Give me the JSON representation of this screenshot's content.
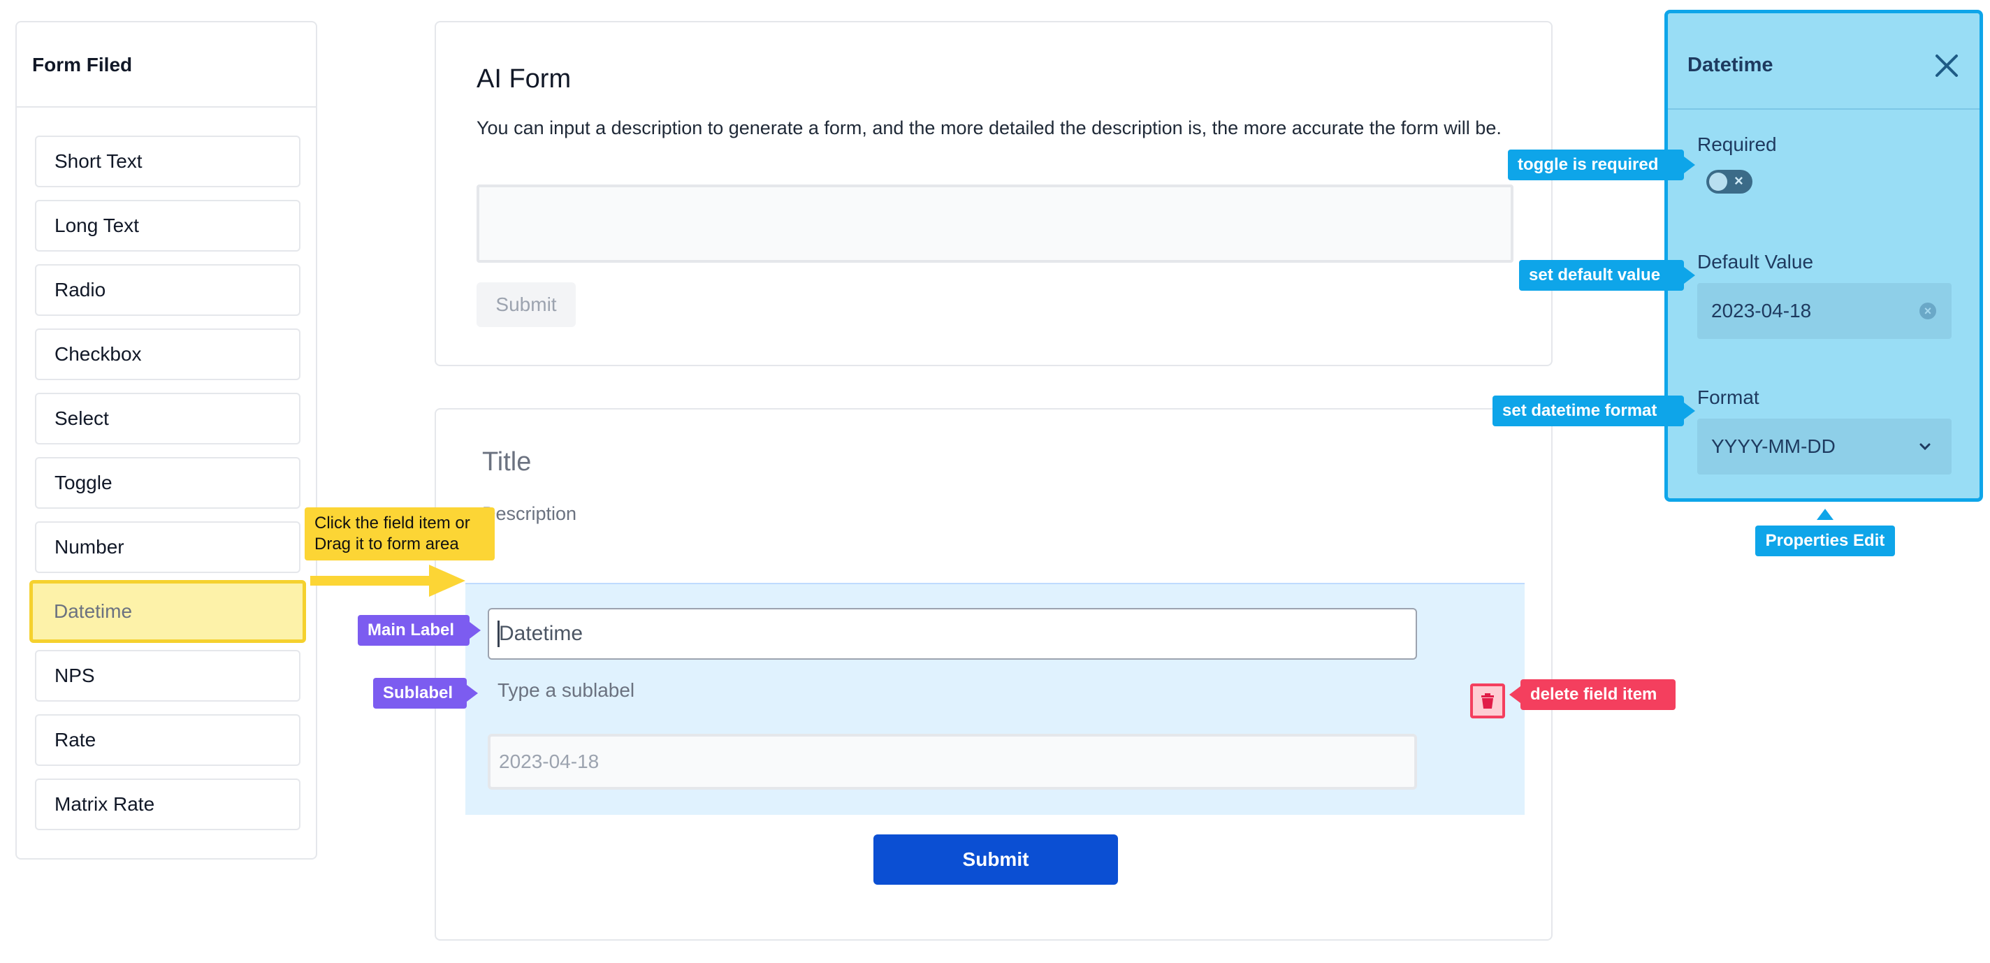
{
  "sidebar": {
    "title": "Form Filed",
    "items": [
      {
        "label": "Short Text"
      },
      {
        "label": "Long Text"
      },
      {
        "label": "Radio"
      },
      {
        "label": "Checkbox"
      },
      {
        "label": "Select"
      },
      {
        "label": "Toggle"
      },
      {
        "label": "Number"
      },
      {
        "label": "Datetime",
        "active": true
      },
      {
        "label": "NPS"
      },
      {
        "label": "Rate"
      },
      {
        "label": "Matrix Rate"
      }
    ]
  },
  "ai_form": {
    "title": "AI Form",
    "description": "You can input a description to generate a form, and the more detailed the description is, the more accurate the form will be.",
    "textarea_value": "",
    "submit_label": "Submit"
  },
  "form": {
    "title": "Title",
    "description": "Description",
    "field": {
      "main_label": "Datetime",
      "sublabel_placeholder": "Type a sublabel",
      "value": "2023-04-18"
    },
    "submit_label": "Submit"
  },
  "properties": {
    "title": "Datetime",
    "required_label": "Required",
    "required": false,
    "default_value_label": "Default Value",
    "default_value": "2023-04-18",
    "format_label": "Format",
    "format_value": "YYYY-MM-DD"
  },
  "annotations": {
    "drag_hint_line1": "Click the field item or",
    "drag_hint_line2": "Drag it to form area",
    "main_label": "Main Label",
    "sublabel": "Sublabel",
    "delete_field": "delete field item",
    "toggle_required": "toggle is required",
    "set_default": "set default value",
    "set_format": "set datetime format",
    "properties_edit": "Properties Edit"
  },
  "colors": {
    "accent_blue": "#0b4fd3",
    "callout_blue": "#0ea5e9",
    "callout_purple": "#7c5cf0",
    "callout_pink": "#f43f5e",
    "highlight_yellow": "#fcd535"
  }
}
